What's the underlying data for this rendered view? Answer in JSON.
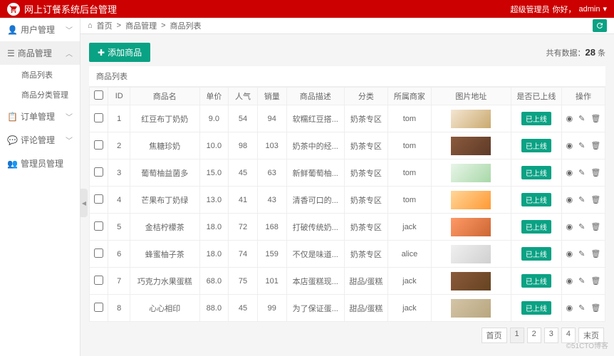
{
  "header": {
    "title": "网上订餐系统后台管理",
    "role": "超级管理员",
    "greeting": "你好，",
    "username": "admin"
  },
  "sidebar": {
    "menus": [
      {
        "label": "用户管理",
        "icon": "user",
        "expanded": false
      },
      {
        "label": "商品管理",
        "icon": "box",
        "expanded": true,
        "children": [
          {
            "label": "商品列表"
          },
          {
            "label": "商品分类管理"
          }
        ]
      },
      {
        "label": "订单管理",
        "icon": "order",
        "expanded": false
      },
      {
        "label": "评论管理",
        "icon": "comment",
        "expanded": false
      },
      {
        "label": "管理员管理",
        "icon": "admin",
        "expanded": false
      }
    ]
  },
  "breadcrumb": {
    "home": "首页",
    "mid": "商品管理",
    "current": "商品列表"
  },
  "toolbar": {
    "add_label": "添加商品",
    "total_prefix": "共有数据：",
    "total_count": "28",
    "total_suffix": " 条"
  },
  "panel": {
    "title": "商品列表"
  },
  "table": {
    "headers": [
      "",
      "ID",
      "商品名",
      "单价",
      "人气",
      "销量",
      "商品描述",
      "分类",
      "所属商家",
      "图片地址",
      "是否已上线",
      "操作"
    ],
    "rows": [
      {
        "id": "1",
        "name": "红豆布丁奶奶",
        "price": "9.0",
        "pop": "54",
        "sales": "94",
        "desc": "软糯红豆搭...",
        "cat": "奶茶专区",
        "merchant": "tom",
        "img": "img-p1",
        "status": "已上线"
      },
      {
        "id": "2",
        "name": "焦糖珍奶",
        "price": "10.0",
        "pop": "98",
        "sales": "103",
        "desc": "奶茶中的经...",
        "cat": "奶茶专区",
        "merchant": "tom",
        "img": "img-p2",
        "status": "已上线"
      },
      {
        "id": "3",
        "name": "葡萄柚益菌多",
        "price": "15.0",
        "pop": "45",
        "sales": "63",
        "desc": "新鲜葡萄柚...",
        "cat": "奶茶专区",
        "merchant": "tom",
        "img": "img-p3",
        "status": "已上线"
      },
      {
        "id": "4",
        "name": "芒果布丁奶绿",
        "price": "13.0",
        "pop": "41",
        "sales": "43",
        "desc": "清香可口的...",
        "cat": "奶茶专区",
        "merchant": "tom",
        "img": "img-p4",
        "status": "已上线"
      },
      {
        "id": "5",
        "name": "金桔柠檬茶",
        "price": "18.0",
        "pop": "72",
        "sales": "168",
        "desc": "打破传统奶...",
        "cat": "奶茶专区",
        "merchant": "jack",
        "img": "img-p5",
        "status": "已上线"
      },
      {
        "id": "6",
        "name": "蜂蜜柚子茶",
        "price": "18.0",
        "pop": "74",
        "sales": "159",
        "desc": "不仅是味道...",
        "cat": "奶茶专区",
        "merchant": "alice",
        "img": "img-p6",
        "status": "已上线"
      },
      {
        "id": "7",
        "name": "巧克力水果蛋糕",
        "price": "68.0",
        "pop": "75",
        "sales": "101",
        "desc": "本店蛋糕现...",
        "cat": "甜品/蛋糕",
        "merchant": "jack",
        "img": "img-p7",
        "status": "已上线"
      },
      {
        "id": "8",
        "name": "心心相印",
        "price": "88.0",
        "pop": "45",
        "sales": "99",
        "desc": "为了保证蛋...",
        "cat": "甜品/蛋糕",
        "merchant": "jack",
        "img": "img-p8",
        "status": "已上线"
      }
    ]
  },
  "pagination": {
    "first": "首页",
    "pages": [
      "1",
      "2",
      "3",
      "4"
    ],
    "last": "末页"
  },
  "watermark": "©51CTO博客"
}
